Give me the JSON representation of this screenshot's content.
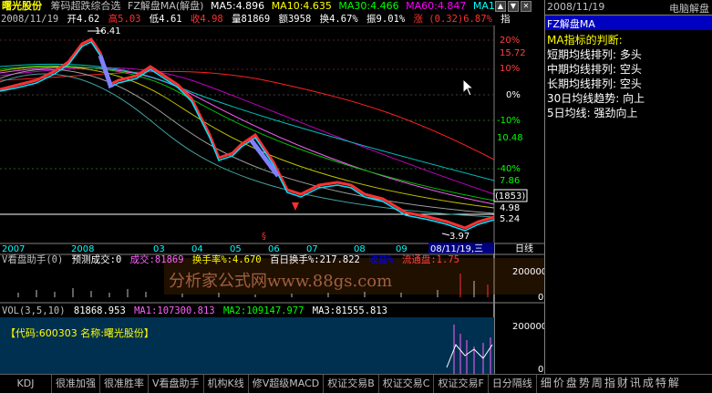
{
  "header": {
    "stock_name": "曙光股份",
    "indicator_name": "筹码超跌综合选",
    "indicator_sub": "FZ解盘MA(解盘)",
    "ma_values": [
      {
        "label": "MA5:4.896",
        "color": "#ffffff"
      },
      {
        "label": "MA10:4.635",
        "color": "#ffff00"
      },
      {
        "label": "MA30:4.466",
        "color": "#00ff00"
      },
      {
        "label": "MA60:4.847",
        "color": "#ff00ff"
      },
      {
        "label": "MA1",
        "color": "#00ffff"
      }
    ],
    "date": "2008/11/19",
    "open": "开4.62",
    "high": "高5.03",
    "low": "低4.61",
    "close": "收4.98",
    "volume": "量81869",
    "amount": "额3958",
    "turnover": "换4.67%",
    "amplitude": "振9.01%",
    "change": "涨 (0.32)6.87%",
    "extra": "指"
  },
  "right_panel": {
    "date": "2008/11/19",
    "title": "电脑解盘",
    "subtitle": "FZ解盘MA",
    "lines": [
      "MA指标的判断:",
      "短期均线排列: 多头",
      "中期均线排列: 空头",
      "长期均线排列: 空头",
      "30日均线趋势: 向上",
      "5日均线: 强劲向上"
    ]
  },
  "price_axis": {
    "labels": [
      {
        "text": "20%",
        "color": "#ff4040"
      },
      {
        "text": "15.72",
        "color": "#ff4040"
      },
      {
        "text": "10%",
        "color": "#ff4040"
      },
      {
        "text": "0%",
        "color": "#ffffff"
      },
      {
        "text": "-10%",
        "color": "#00ff00"
      },
      {
        "text": "10.48",
        "color": "#00ff00"
      },
      {
        "text": "-40%",
        "color": "#00ff00"
      },
      {
        "text": "7.86",
        "color": "#00ff00"
      },
      {
        "text": "(1853)",
        "color": "#ffffff"
      },
      {
        "text": "4.98",
        "color": "#ffffff"
      },
      {
        "text": "5.24",
        "color": "#ffffff"
      }
    ],
    "high_marker": "16.41",
    "low_marker": "3.97"
  },
  "date_axis": {
    "labels": [
      "2007",
      "2008",
      "03",
      "04",
      "05",
      "06",
      "07",
      "08",
      "09",
      "08/11/19,三"
    ],
    "period": "日线"
  },
  "vpanel": {
    "title": "V看盘助手(0)",
    "predict": "预测成交:0",
    "volume_label": "成交:81869",
    "turnover_label": "换手率%:4.670",
    "hundred_day": "百日换手%:217.822",
    "amount_label": "收益%",
    "float_label": "流通盘:1.75",
    "axis": [
      "200000",
      "0"
    ],
    "watermark": "分析家公式网www.88gs.com"
  },
  "vol_panel": {
    "title": "VOL(3,5,10)",
    "vol": "81868.953",
    "ma1": "MA1:107300.813",
    "ma2": "MA2:109147.977",
    "ma3": "MA3:81555.813",
    "code_line": "【代码:600303 名称:曙光股份】",
    "axis": [
      "200000",
      "0"
    ]
  },
  "tabs": [
    "KDJ",
    "很准加强",
    "很准胜率",
    "V看盘助手",
    "机构K线",
    "修V超级MACD",
    "权证交易B",
    "权证交易C",
    "权证交易F",
    "日分隔线"
  ],
  "tabs_right": "细价盘势周指财讯成特解",
  "colors": {
    "up": "#ff3030",
    "down": "#00ffff",
    "bg": "#000000",
    "panel_blue": "#000080"
  }
}
